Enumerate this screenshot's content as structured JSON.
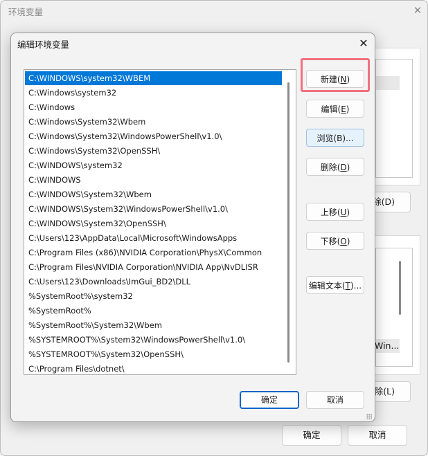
{
  "background_window": {
    "title": "环境变量",
    "close_glyph": "✕",
    "delete_user_fragment": "除(D)",
    "win_fragment": "Win...",
    "delete_system_fragment": "除(L)",
    "ok_label": "确定",
    "cancel_label": "取消"
  },
  "dialog": {
    "title": "编辑环境变量",
    "close_glyph": "✕",
    "paths": [
      "C:\\WINDOWS\\system32\\WBEM",
      "C:\\Windows\\system32",
      "C:\\Windows",
      "C:\\Windows\\System32\\Wbem",
      "C:\\Windows\\System32\\WindowsPowerShell\\v1.0\\",
      "C:\\Windows\\System32\\OpenSSH\\",
      "C:\\WINDOWS\\system32",
      "C:\\WINDOWS",
      "C:\\WINDOWS\\System32\\Wbem",
      "C:\\WINDOWS\\System32\\WindowsPowerShell\\v1.0\\",
      "C:\\WINDOWS\\System32\\OpenSSH\\",
      "C:\\Users\\123\\AppData\\Local\\Microsoft\\WindowsApps",
      "C:\\Program Files (x86)\\NVIDIA Corporation\\PhysX\\Common",
      "C:\\Program Files\\NVIDIA Corporation\\NVIDIA App\\NvDLISR",
      "C:\\Users\\123\\Downloads\\ImGui_BD2\\DLL",
      "%SystemRoot%\\system32",
      "%SystemRoot%",
      "%SystemRoot%\\System32\\Wbem",
      "%SYSTEMROOT%\\System32\\WindowsPowerShell\\v1.0\\",
      "%SYSTEMROOT%\\System32\\OpenSSH\\",
      "C:\\Program Files\\dotnet\\"
    ],
    "buttons": {
      "new": {
        "text": "新建(",
        "key": "N",
        "end": ")"
      },
      "edit": {
        "text": "编辑(",
        "key": "E",
        "end": ")"
      },
      "browse": {
        "text": "浏览(B)...",
        "key": "",
        "end": ""
      },
      "delete": {
        "text": "删除(",
        "key": "D",
        "end": ")"
      },
      "move_up": {
        "text": "上移(",
        "key": "U",
        "end": ")"
      },
      "move_down": {
        "text": "下移(",
        "key": "O",
        "end": ")"
      },
      "edit_text": {
        "text": "编辑文本(",
        "key": "T",
        "end": ")..."
      }
    },
    "ok_label": "确定",
    "cancel_label": "取消"
  },
  "colors": {
    "selection": "#0078d7",
    "highlight": "#f2707f"
  }
}
